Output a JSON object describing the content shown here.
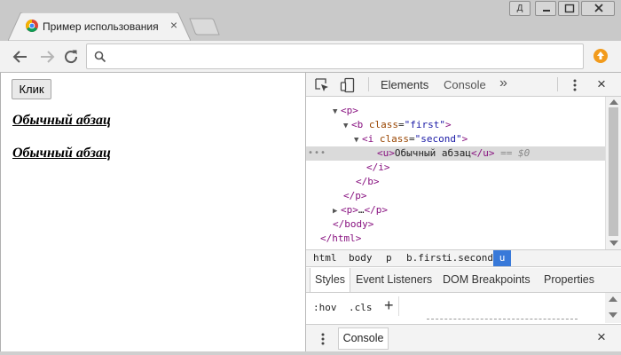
{
  "window": {
    "user_button_label": "Д",
    "active_tab": {
      "title": "Пример использования jQ",
      "favicon": "chrome-icon"
    },
    "controls": [
      "minimize-icon",
      "maximize-icon",
      "close-icon"
    ]
  },
  "toolbar": {
    "address_value": "",
    "icons": [
      "back-arrow-icon",
      "forward-arrow-icon",
      "reload-icon",
      "search-icon",
      "extension-icon"
    ]
  },
  "page": {
    "button_label": "Клик",
    "paragraphs": [
      "Обычный абзац",
      "Обычный абзац"
    ]
  },
  "devtools": {
    "tabs": {
      "elements": "Elements",
      "console": "Console",
      "more": "»"
    },
    "dom_lines": [
      {
        "open": "<p>"
      },
      {
        "tag_open": "<b",
        "attr_name": "class",
        "attr_value": "\"first\"",
        "tag_end": ">"
      },
      {
        "tag_open": "<i",
        "attr_name": "class",
        "attr_value": "\"second\"",
        "tag_end": ">"
      },
      {
        "open": "<u>",
        "text": "Обычный абзац",
        "close": "</u>",
        "marker": " == $0"
      },
      {
        "close": "</i>"
      },
      {
        "close": "</b>"
      },
      {
        "close": "</p>"
      },
      {
        "open": "<p>",
        "text": "…",
        "close": "</p>"
      },
      {
        "close": "</body>"
      },
      {
        "close": "</html>"
      }
    ],
    "dots": "•••",
    "breadcrumbs": [
      "html",
      "body",
      "p",
      "b.first",
      "i.second",
      "u"
    ],
    "active_crumb": "u",
    "style_tabs": [
      "Styles",
      "Event Listeners",
      "DOM Breakpoints",
      "Properties"
    ],
    "filter": {
      "hov": ":hov",
      "cls": ".cls",
      "plus": "+"
    },
    "drawer_tab": "Console"
  }
}
